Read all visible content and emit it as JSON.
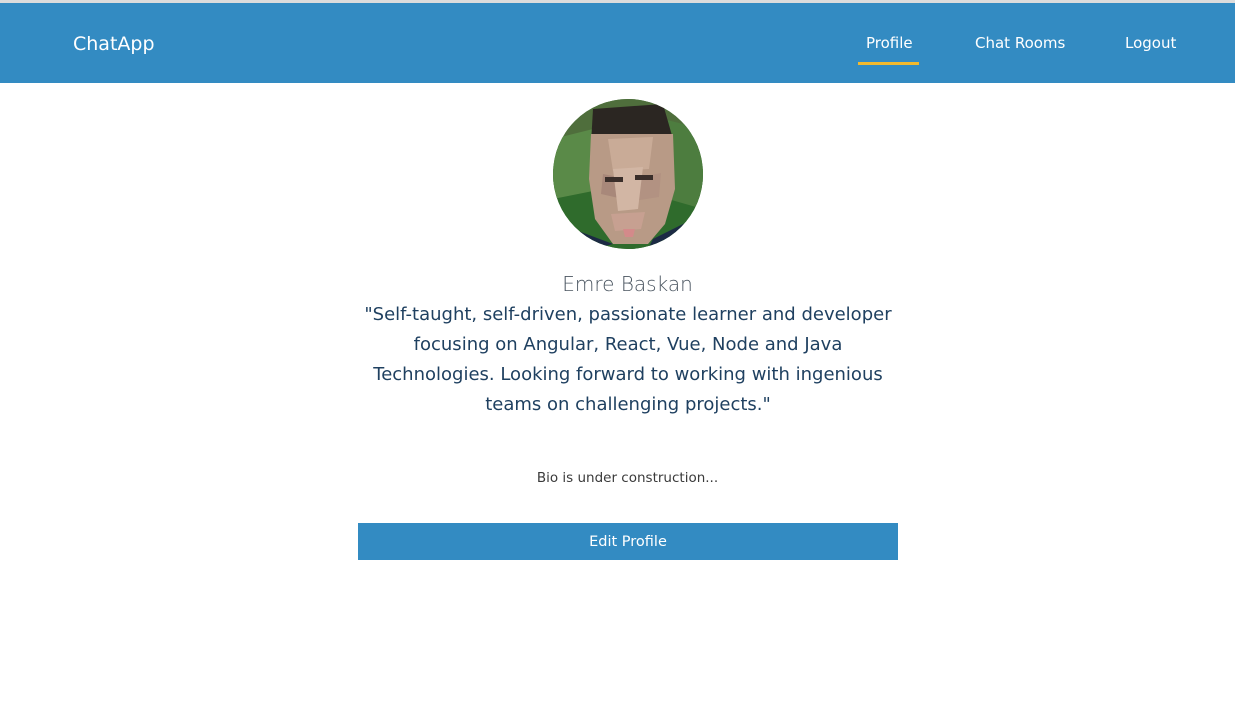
{
  "navbar": {
    "brand": "ChatApp",
    "links": [
      {
        "label": "Profile",
        "active": true
      },
      {
        "label": "Chat Rooms",
        "active": false
      },
      {
        "label": "Logout",
        "active": false
      }
    ]
  },
  "profile": {
    "name": "Emre Baskan",
    "quote": "\"Self-taught, self-driven, passionate learner and developer focusing on Angular, React, Vue, Node and Java Technologies. Looking forward to working with ingenious teams on challenging projects.\"",
    "bio": "Bio is under construction...",
    "edit_button": "Edit Profile"
  },
  "colors": {
    "primary": "#338bc2",
    "active_underline": "#f2b92d",
    "quote_text": "#1f4060"
  }
}
